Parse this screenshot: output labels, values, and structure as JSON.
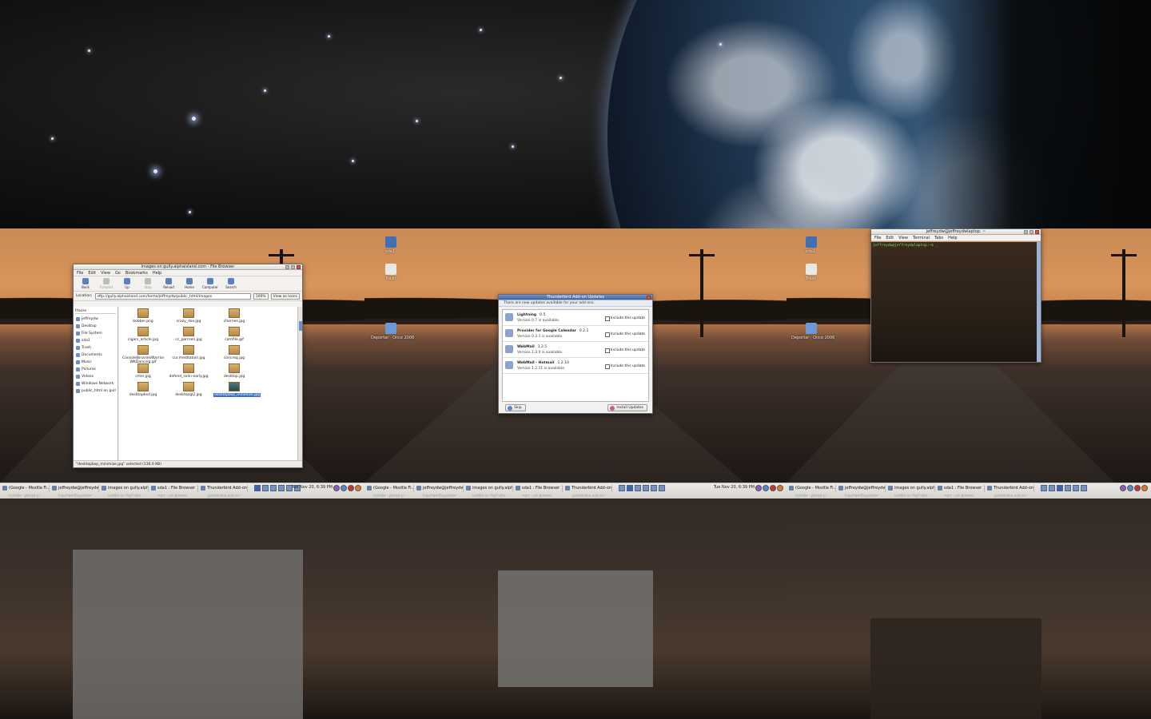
{
  "desktops": [
    {
      "icons": [],
      "file_browser": {
        "title": "images on gully.alphaisland.com - File Browser",
        "menu": [
          "File",
          "Edit",
          "View",
          "Go",
          "Bookmarks",
          "Help"
        ],
        "toolbar": [
          {
            "label": "Back",
            "enabled": true
          },
          {
            "label": "Forward",
            "enabled": false
          },
          {
            "label": "Up",
            "enabled": true
          },
          {
            "label": "Stop",
            "enabled": false
          },
          {
            "label": "Reload",
            "enabled": true
          },
          {
            "label": "Home",
            "enabled": true
          },
          {
            "label": "Computer",
            "enabled": true
          },
          {
            "label": "Search",
            "enabled": true
          }
        ],
        "location_label": "Location:",
        "location_value": "sftp://gully.alphaisland.com/home/jeffreydw/public_html/images",
        "zoom": "100%",
        "view_mode": "View as Icons",
        "places_header": "Places",
        "places": [
          "jeffreydw",
          "Desktop",
          "File System",
          "sda1",
          "Trash",
          "Documents",
          "Music",
          "Pictures",
          "Videos",
          "Windows Network",
          "public_html on gully.a"
        ],
        "files": [
          {
            "name": "bobber.png",
            "selected": false
          },
          {
            "name": "crazy_dev.jpg",
            "selected": false
          },
          {
            "name": "cherries.jpg",
            "selected": false
          },
          {
            "name": "cigars_article.jpg",
            "selected": false
          },
          {
            "name": "cc_parrnen.jpg",
            "selected": false
          },
          {
            "name": "comfile.gif",
            "selected": false
          },
          {
            "name": "ConsoleBinariesWarrior WKDancing.gif",
            "selected": false
          },
          {
            "name": "cur.meditation.jpg",
            "selected": false
          },
          {
            "name": "concreg.jpg",
            "selected": false
          },
          {
            "name": "cmer.jpg",
            "selected": false
          },
          {
            "name": "defend_solin-early.jpg",
            "selected": false
          },
          {
            "name": "desktop.jpg",
            "selected": false
          },
          {
            "name": "desktopbsd.jpg",
            "selected": false
          },
          {
            "name": "desktopgl2.jpg",
            "selected": false
          },
          {
            "name": "desktopbsp_minimize.jpg",
            "selected": true
          }
        ],
        "status": "\"desktopbsp_minimize.jpg\" selected (136.0 KB)"
      }
    },
    {
      "icons": [
        {
          "name": "sda1"
        },
        {
          "name": "Trash"
        },
        {
          "name": "Deportar · Once 2006"
        }
      ],
      "updates_dialog": {
        "title": "Thunderbird Add-on Updates",
        "note": "There are new updates available for your add-ons.",
        "items": [
          {
            "name": "Lightning",
            "version": "0.5",
            "available": "Version 0.7 is available.",
            "include": "Include this update"
          },
          {
            "name": "Provider for Google Calendar",
            "version": "0.2.1",
            "available": "Version 0.3.1 is available.",
            "include": "Include this update"
          },
          {
            "name": "WebMail",
            "version": "1.2.5",
            "available": "Version 1.3.0 is available.",
            "include": "Include this update"
          },
          {
            "name": "WebMail - Hotmail",
            "version": "1.2.10",
            "available": "Version 1.2.11 is available.",
            "include": "Include this update"
          }
        ],
        "skip_label": "Skip",
        "install_label": "Install Updates"
      }
    },
    {
      "icons": [
        {
          "name": "sda1"
        },
        {
          "name": "Trash"
        },
        {
          "name": "Deportar · Once 2006"
        }
      ],
      "terminal": {
        "title": "jeffreydw@jeffreydwlaptop: ~",
        "menu": [
          "File",
          "Edit",
          "View",
          "Terminal",
          "Tabs",
          "Help"
        ],
        "prompt": "jeffreydw@jeffreydwlaptop:~$ _"
      }
    }
  ],
  "taskbars": [
    {
      "items": [
        "(Google - Mozilla Fi...",
        "jeffreydw@jeffreydw...",
        "images on gully.alph...",
        "sda1 : File Browser",
        "Thunderbird Add-on..."
      ],
      "clock": "Tue Nov 20,  6:39 PM"
    },
    {
      "items": [
        "(Google - Mozilla Fi...",
        "jeffreydw@jeffreydw...",
        "images on gully.alph...",
        "sda1 : File Browser",
        "Thunderbird Add-on..."
      ],
      "clock": "Tue Nov 20,  6:39 PM"
    },
    {
      "items": [
        "(Google - Mozilla Fi...",
        "jeffreydw@jeffreydw...",
        "images on gully.alph...",
        "sda1 : File Browser",
        "Thunderbird Add-on..."
      ],
      "clock": ""
    }
  ]
}
